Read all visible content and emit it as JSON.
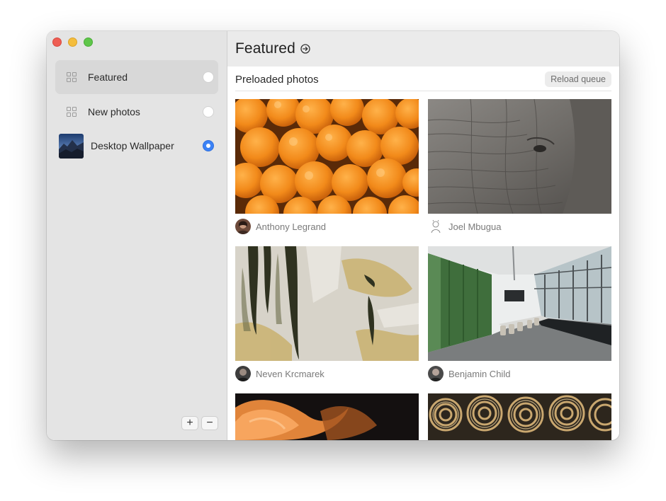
{
  "window": {
    "controls": [
      "close",
      "minimize",
      "zoom"
    ]
  },
  "sidebar": {
    "items": [
      {
        "label": "Featured",
        "icon": "collection-grid-icon",
        "selected": true,
        "active": false
      },
      {
        "label": "New photos",
        "icon": "collection-grid-icon",
        "selected": false,
        "active": false
      },
      {
        "label": "Desktop Wallpaper",
        "icon": "wallpaper-thumbnail",
        "selected": false,
        "active": true
      }
    ],
    "add_label": "+",
    "remove_label": "−"
  },
  "header": {
    "title": "Featured",
    "title_icon": "arrow-circle-right-icon"
  },
  "content": {
    "section_title": "Preloaded photos",
    "reload_label": "Reload queue",
    "photos": [
      {
        "author": "Anthony Legrand",
        "subject": "apricots"
      },
      {
        "author": "Joel Mbugua",
        "subject": "elephant"
      },
      {
        "author": "Neven Krcmarek",
        "subject": "textured wall"
      },
      {
        "author": "Benjamin Child",
        "subject": "conference room"
      },
      {
        "author": "",
        "subject": "orange smoke"
      },
      {
        "author": "",
        "subject": "woven pattern"
      }
    ]
  },
  "colors": {
    "accent": "#3b82f6",
    "sidebar_bg": "#e4e4e4",
    "header_bg": "#ebebeb"
  }
}
